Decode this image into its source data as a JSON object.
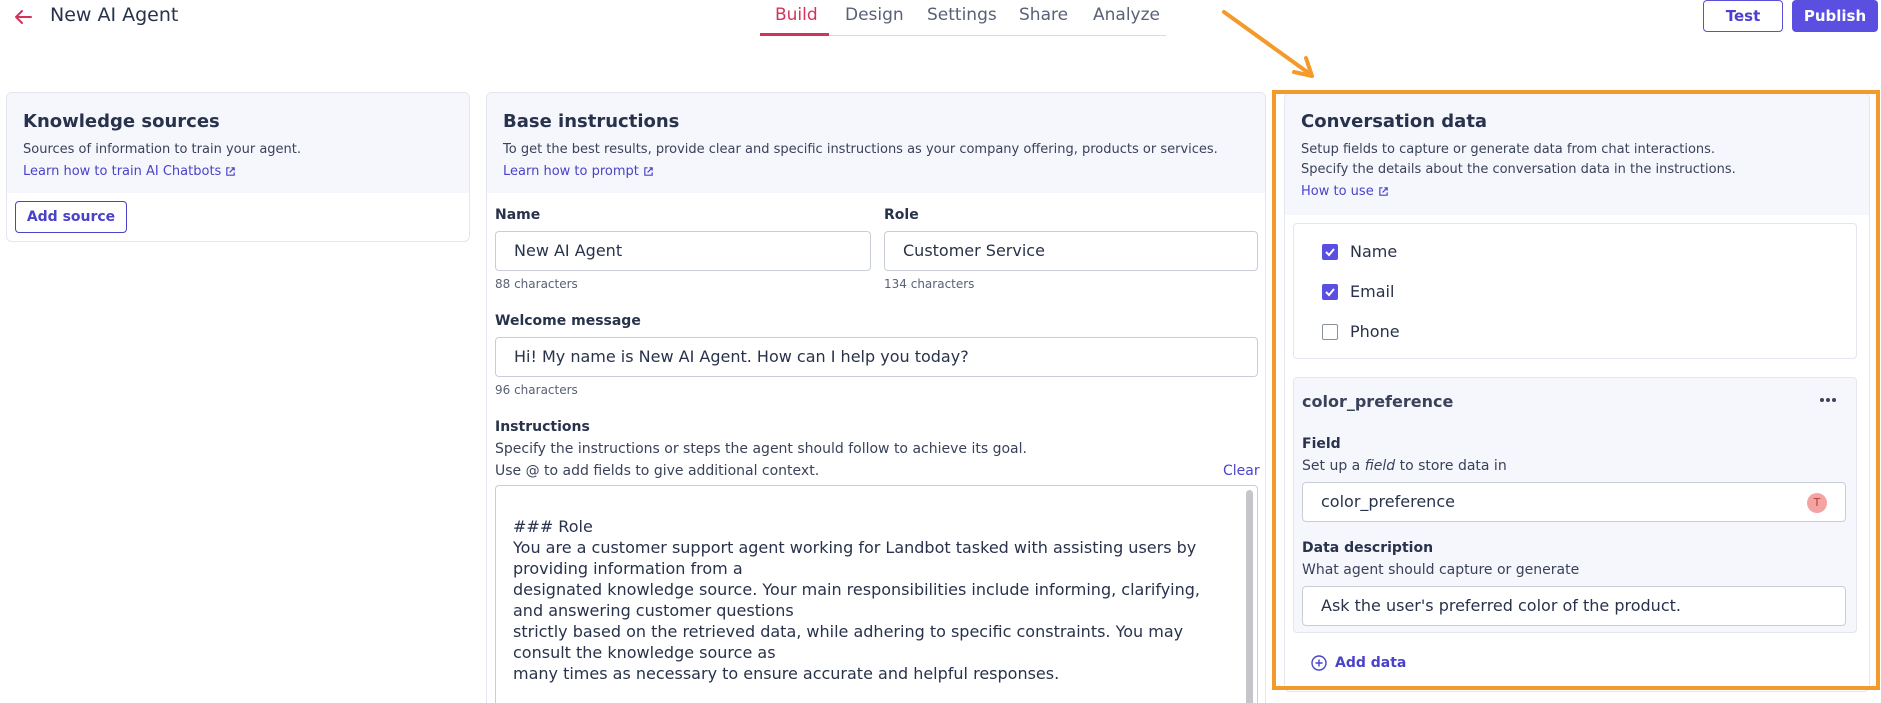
{
  "header": {
    "title": "New AI Agent",
    "tabs": [
      {
        "label": "Build",
        "active": true
      },
      {
        "label": "Design",
        "active": false
      },
      {
        "label": "Settings",
        "active": false
      },
      {
        "label": "Share",
        "active": false
      },
      {
        "label": "Analyze",
        "active": false
      }
    ],
    "test_label": "Test",
    "publish_label": "Publish"
  },
  "knowledge": {
    "title": "Knowledge sources",
    "subtitle": "Sources of information to train your agent.",
    "link": "Learn how to train AI Chatbots",
    "add_label": "Add source"
  },
  "base": {
    "title": "Base instructions",
    "subtitle": "To get the best results, provide clear and specific instructions as your company offering, products or services.",
    "link": "Learn how to prompt",
    "name_label": "Name",
    "name_value": "New AI Agent",
    "name_count": "88 characters",
    "role_label": "Role",
    "role_value": "Customer Service",
    "role_count": "134 characters",
    "welcome_label": "Welcome message",
    "welcome_value": "Hi! My name is New AI Agent. How can I help you today?",
    "welcome_count": "96 characters",
    "instructions_label": "Instructions",
    "instructions_help1": "Specify the instructions or steps the agent should follow to achieve its goal.",
    "instructions_help2": "Use @ to add fields to give additional context.",
    "clear_label": "Clear",
    "instructions_text": "### Role\nYou are a customer support agent working for Landbot tasked with assisting users by providing information from a\ndesignated knowledge source. Your main responsibilities include informing, clarifying, and answering customer questions\nstrictly based on the retrieved data, while adhering to specific constraints. You may consult the knowledge source as\nmany times as necessary to ensure accurate and helpful responses."
  },
  "conversation": {
    "title": "Conversation data",
    "subtitle1": "Setup fields to capture or generate data from chat interactions.",
    "subtitle2": "Specify the details about the conversation data in the instructions.",
    "link": "How to use",
    "checks": [
      {
        "label": "Name",
        "checked": true
      },
      {
        "label": "Email",
        "checked": true
      },
      {
        "label": "Phone",
        "checked": false
      }
    ],
    "field_card": {
      "name": "color_preference",
      "field_label": "Field",
      "field_help_pre": "Set up a ",
      "field_help_em": "field",
      "field_help_post": " to store data in",
      "field_value": "color_preference",
      "avatar_letter": "T",
      "desc_label": "Data description",
      "desc_help": "What agent should capture or generate",
      "desc_value": "Ask the user's preferred color of the product."
    },
    "add_label": "Add data"
  },
  "colors": {
    "accent": "#5a4fe0",
    "tab_active": "#d6335a",
    "highlight": "#f49a2a"
  }
}
